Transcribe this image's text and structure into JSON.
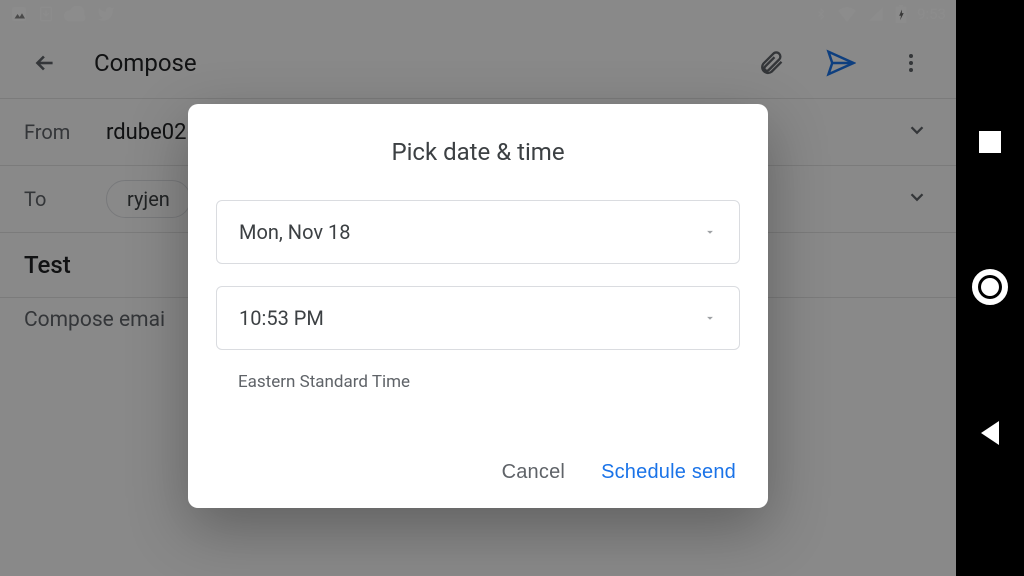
{
  "statusbar": {
    "time": "9:53"
  },
  "appbar": {
    "title": "Compose"
  },
  "compose": {
    "from_label": "From",
    "from_value": "rdube02(",
    "to_label": "To",
    "to_chip": "ryjen",
    "subject": "Test",
    "body_placeholder": "Compose emai"
  },
  "dialog": {
    "title": "Pick date & time",
    "date": "Mon, Nov 18",
    "time": "10:53 PM",
    "timezone": "Eastern Standard Time",
    "cancel": "Cancel",
    "confirm": "Schedule send"
  }
}
